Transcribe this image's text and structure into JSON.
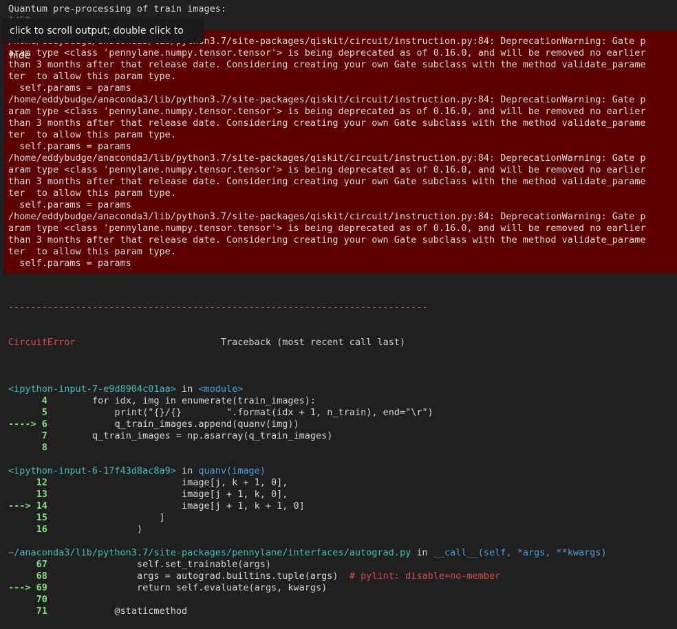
{
  "stdout": {
    "title": "Quantum pre-processing of train images:",
    "counter": "1/50"
  },
  "tooltip": "click to scroll output; double click to hide",
  "stderr": [
    "/home/eddybudge/anaconda3/lib/python3.7/site-packages/qiskit/circuit/instruction.py:84: DeprecationWarning: Gate p",
    "aram type <class 'pennylane.numpy.tensor.tensor'> is being deprecated as of 0.16.0, and will be removed no earlier",
    "than 3 months after that release date. Considering creating your own Gate subclass with the method validate_parame",
    "ter  to allow this param type.",
    "  self.params = params",
    "/home/eddybudge/anaconda3/lib/python3.7/site-packages/qiskit/circuit/instruction.py:84: DeprecationWarning: Gate p",
    "aram type <class 'pennylane.numpy.tensor.tensor'> is being deprecated as of 0.16.0, and will be removed no earlier",
    "than 3 months after that release date. Considering creating your own Gate subclass with the method validate_parame",
    "ter  to allow this param type.",
    "  self.params = params",
    "/home/eddybudge/anaconda3/lib/python3.7/site-packages/qiskit/circuit/instruction.py:84: DeprecationWarning: Gate p",
    "aram type <class 'pennylane.numpy.tensor.tensor'> is being deprecated as of 0.16.0, and will be removed no earlier",
    "than 3 months after that release date. Considering creating your own Gate subclass with the method validate_parame",
    "ter  to allow this param type.",
    "  self.params = params",
    "/home/eddybudge/anaconda3/lib/python3.7/site-packages/qiskit/circuit/instruction.py:84: DeprecationWarning: Gate p",
    "aram type <class 'pennylane.numpy.tensor.tensor'> is being deprecated as of 0.16.0, and will be removed no earlier",
    "than 3 months after that release date. Considering creating your own Gate subclass with the method validate_parame",
    "ter  to allow this param type.",
    "  self.params = params"
  ],
  "traceback": {
    "separator": "---------------------------------------------------------------------------",
    "error_name": "CircuitError",
    "header_right": "                          Traceback (most recent call last)",
    "frames": [
      {
        "file": "<ipython-input-7-e9d8904c01aa>",
        "in_word": " in ",
        "func": "<module>",
        "lines": [
          {
            "arrow": "      ",
            "num": "4",
            "code": "    for idx, img in enumerate(train_images):"
          },
          {
            "arrow": "      ",
            "num": "5",
            "code": "        print(\"{}/{}        \".format(idx + 1, n_train), end=\"\\r\")"
          },
          {
            "arrow": "----> ",
            "num": "6",
            "code": "        q_train_images.append(quanv(img))"
          },
          {
            "arrow": "      ",
            "num": "7",
            "code": "    q_train_images = np.asarray(q_train_images)"
          },
          {
            "arrow": "      ",
            "num": "8",
            "code": ""
          }
        ]
      },
      {
        "file": "<ipython-input-6-17f43d8ac8a9>",
        "in_word": " in ",
        "func": "quanv(image)",
        "lines": [
          {
            "arrow": "     ",
            "num": "12",
            "code": "                    image[j, k + 1, 0],"
          },
          {
            "arrow": "     ",
            "num": "13",
            "code": "                    image[j + 1, k, 0],"
          },
          {
            "arrow": "---> ",
            "num": "14",
            "code": "                    image[j + 1, k + 1, 0]"
          },
          {
            "arrow": "     ",
            "num": "15",
            "code": "                ]"
          },
          {
            "arrow": "     ",
            "num": "16",
            "code": "            )"
          }
        ]
      },
      {
        "file": "~/anaconda3/lib/python3.7/site-packages/pennylane/interfaces/autograd.py",
        "in_word": " in ",
        "func": "__call__(self, *args, **kwargs)",
        "lines": [
          {
            "arrow": "     ",
            "num": "67",
            "code": "            self.set_trainable(args)"
          },
          {
            "arrow": "     ",
            "num": "68",
            "code": "            args = autograd.builtins.tuple(args)  # pylint: disable=no-member"
          },
          {
            "arrow": "---> ",
            "num": "69",
            "code": "            return self.evaluate(args, kwargs)"
          },
          {
            "arrow": "     ",
            "num": "70",
            "code": ""
          },
          {
            "arrow": "     ",
            "num": "71",
            "code": "        @staticmethod"
          }
        ]
      }
    ]
  }
}
